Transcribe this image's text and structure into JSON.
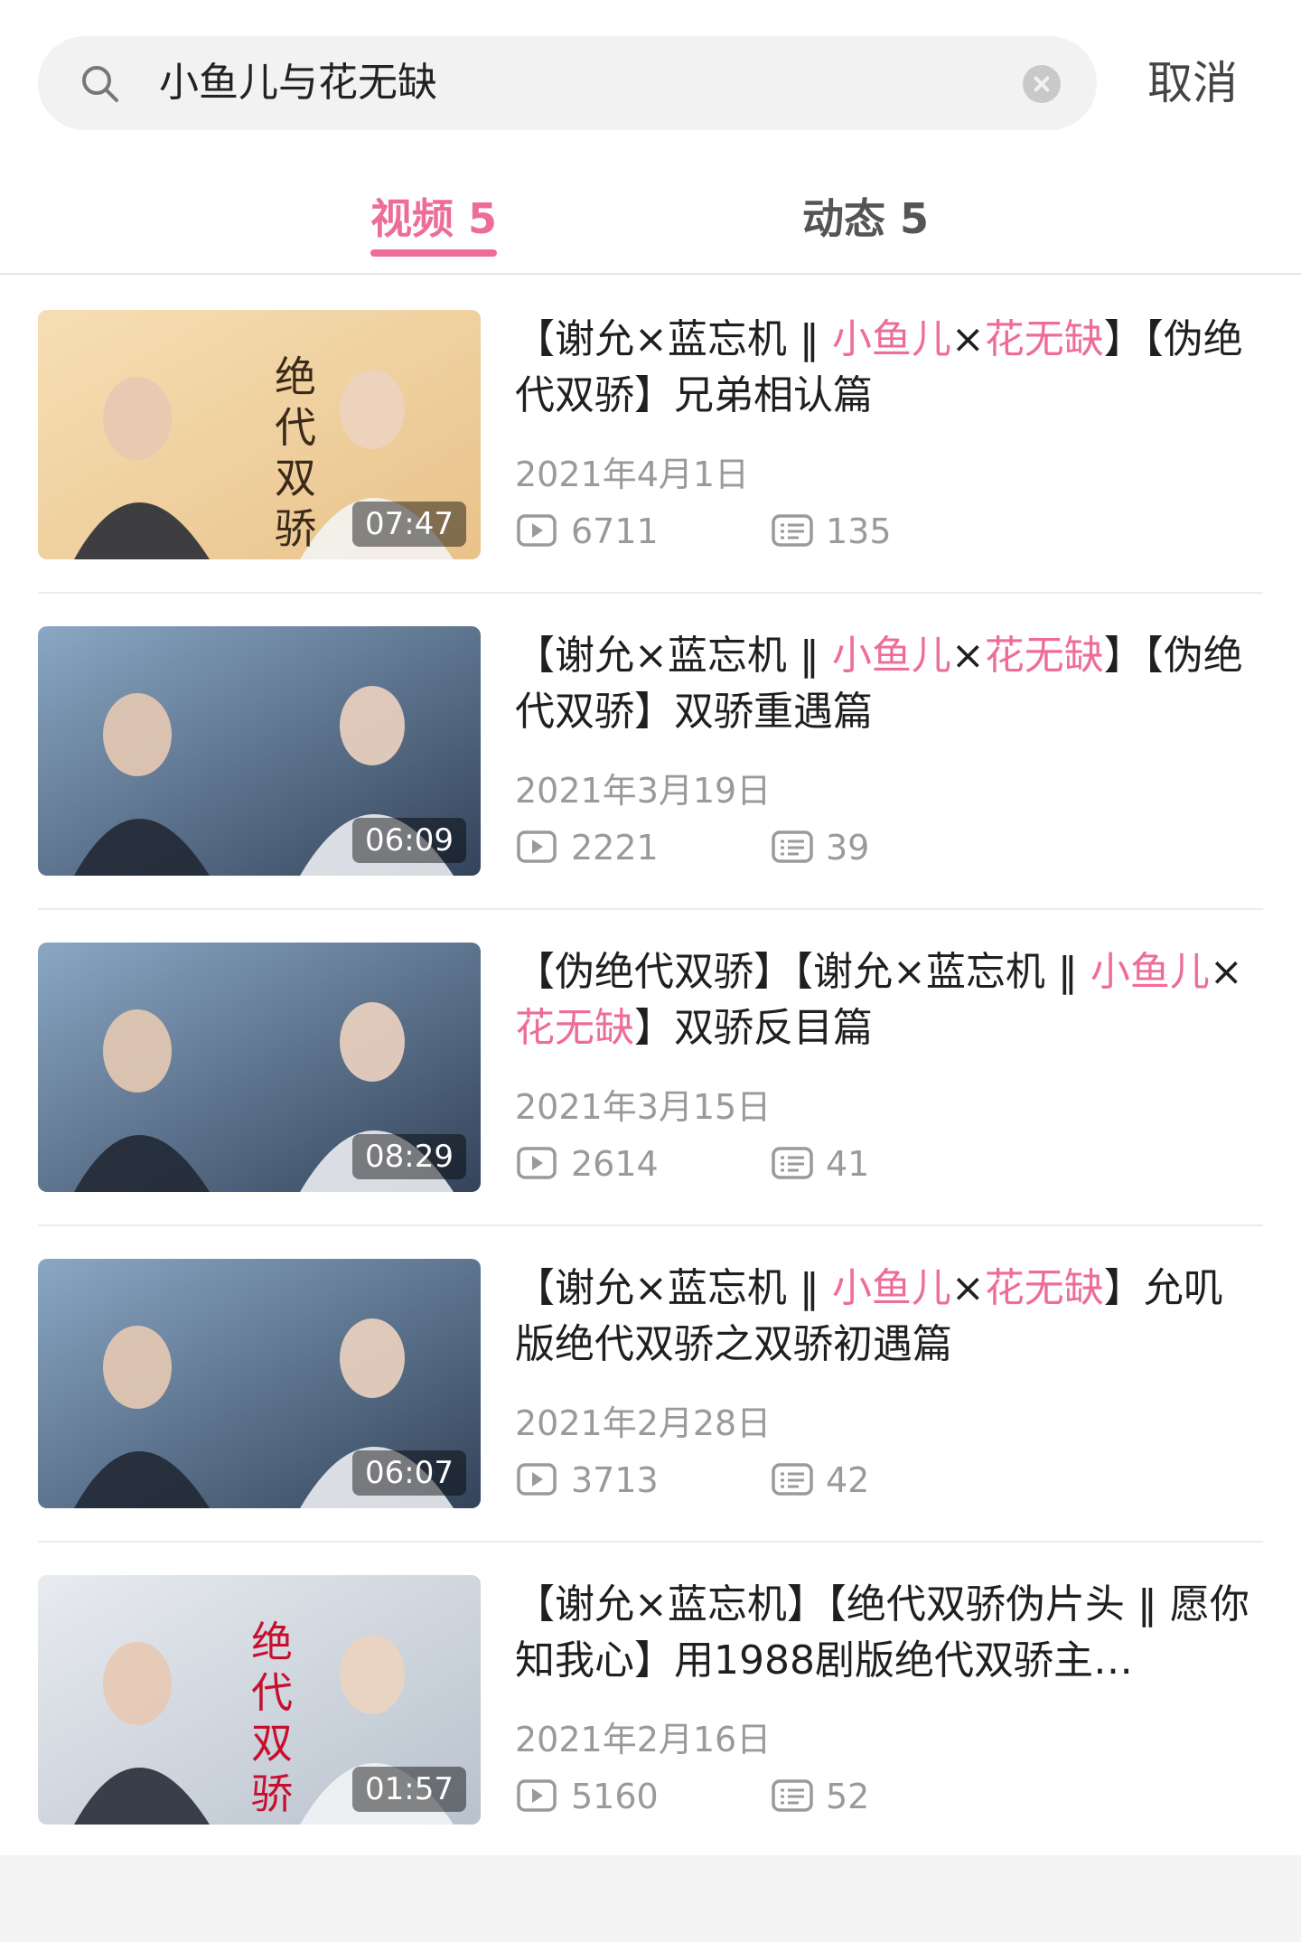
{
  "search": {
    "query": "小鱼儿与花无缺",
    "cancel_label": "取消"
  },
  "tabs": [
    {
      "label": "视频 5",
      "active": true
    },
    {
      "label": "动态 5",
      "active": false
    }
  ],
  "colors": {
    "accent": "#ee6d97",
    "text": "#1f1f1f",
    "meta": "#9a9a9a"
  },
  "videos": [
    {
      "duration": "07:47",
      "title_parts": [
        "【谢允×蓝忘机 ‖ ",
        "小鱼儿",
        "×",
        "花无缺",
        "】【伪绝代双骄】兄弟相认篇"
      ],
      "date": "2021年4月1日",
      "plays": "6711",
      "comments": "135",
      "thumb_text": "绝代双骄"
    },
    {
      "duration": "06:09",
      "title_parts": [
        "【谢允×蓝忘机 ‖ ",
        "小鱼儿",
        "×",
        "花无缺",
        "】【伪绝代双骄】双骄重遇篇"
      ],
      "date": "2021年3月19日",
      "plays": "2221",
      "comments": "39"
    },
    {
      "duration": "08:29",
      "title_parts": [
        "【伪绝代双骄】【谢允×蓝忘机 ‖ ",
        "小鱼儿",
        "×",
        "花无缺",
        "】双骄反目篇"
      ],
      "date": "2021年3月15日",
      "plays": "2614",
      "comments": "41"
    },
    {
      "duration": "06:07",
      "title_parts": [
        "【谢允×蓝忘机 ‖ ",
        "小鱼儿",
        "×",
        "花无缺",
        "】允叽版绝代双骄之双骄初遇篇"
      ],
      "date": "2021年2月28日",
      "plays": "3713",
      "comments": "42"
    },
    {
      "duration": "01:57",
      "title_parts": [
        "【谢允×蓝忘机】【绝代双骄伪片头 ‖ 愿你知我心】用1988剧版绝代双骄主…",
        "",
        "",
        "",
        ""
      ],
      "date": "2021年2月16日",
      "plays": "5160",
      "comments": "52",
      "thumb_text": "绝代双骄"
    }
  ]
}
